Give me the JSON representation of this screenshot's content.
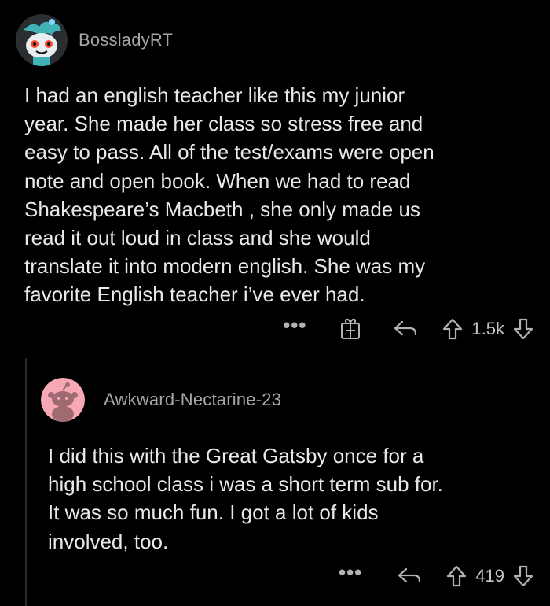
{
  "comments": [
    {
      "username": "BossladyRT",
      "text": "I had an english teacher like this my junior\nyear. She made her class so stress free and\neasy to pass. All of the test/exams were open\nnote and open book. When we had to read\nShakespeare’s  Macbeth , she only made us\nread it out loud in class and she would\ntranslate it into modern english. She was my\nfavorite English teacher i’ve ever had.",
      "more": "•••",
      "votes": "1.5k",
      "icons": [
        "more-options-icon",
        "award-gift-icon",
        "reply-icon",
        "upvote-icon",
        "downvote-icon"
      ]
    },
    {
      "username": "Awkward-Nectarine-23",
      "text": "I did this with the Great Gatsby once for a\nhigh school class i was a short term sub for.\nIt was so much fun. I got a lot of kids\ninvolved, too.",
      "more": "•••",
      "votes": "419",
      "icons": [
        "more-options-icon",
        "reply-icon",
        "upvote-icon",
        "downvote-icon"
      ]
    }
  ],
  "colors": {
    "background": "#000000",
    "text": "#e6e8ea",
    "meta": "#a4a7aa",
    "thread_line": "#2a2a2b",
    "avatar2_bg": "#f6a8b5"
  }
}
